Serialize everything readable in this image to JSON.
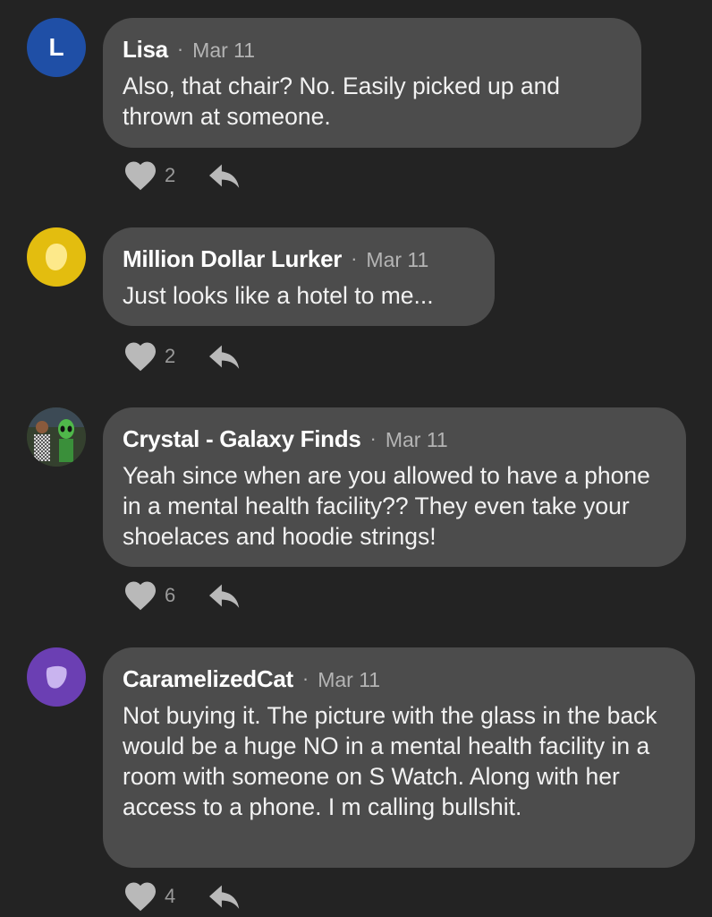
{
  "comments": [
    {
      "author": "Lisa",
      "avatar_letter": "L",
      "avatar_color": "#1f4fa6",
      "date": "Mar 11",
      "text": "Also, that chair? No. Easily picked up and thrown at someone.",
      "likes": "2"
    },
    {
      "author": "Million Dollar Lurker",
      "avatar_color": "#e3bd0f",
      "date": "Mar 11",
      "text": "Just looks like a hotel to me...",
      "likes": "2"
    },
    {
      "author": "Crystal - Galaxy Finds",
      "date": "Mar 11",
      "text": "Yeah since when are you allowed to have a phone in a mental health facility?? They even take your shoelaces and hoodie strings!",
      "likes": "6"
    },
    {
      "author": "CaramelizedCat",
      "avatar_color": "#6b3fb3",
      "date": "Mar 11",
      "text": "Not buying it. The picture with the glass in the back would be a huge NO in a mental health facility in a room with someone on S Watch. Along with her access to a phone. I m calling bullshit.",
      "likes": "4"
    }
  ],
  "separator": "·",
  "icons": {
    "like": "heart-icon",
    "reply": "reply-arrow-icon"
  },
  "colors": {
    "background": "#232323",
    "bubble": "#4c4c4c",
    "icon": "#b9b9b9"
  }
}
